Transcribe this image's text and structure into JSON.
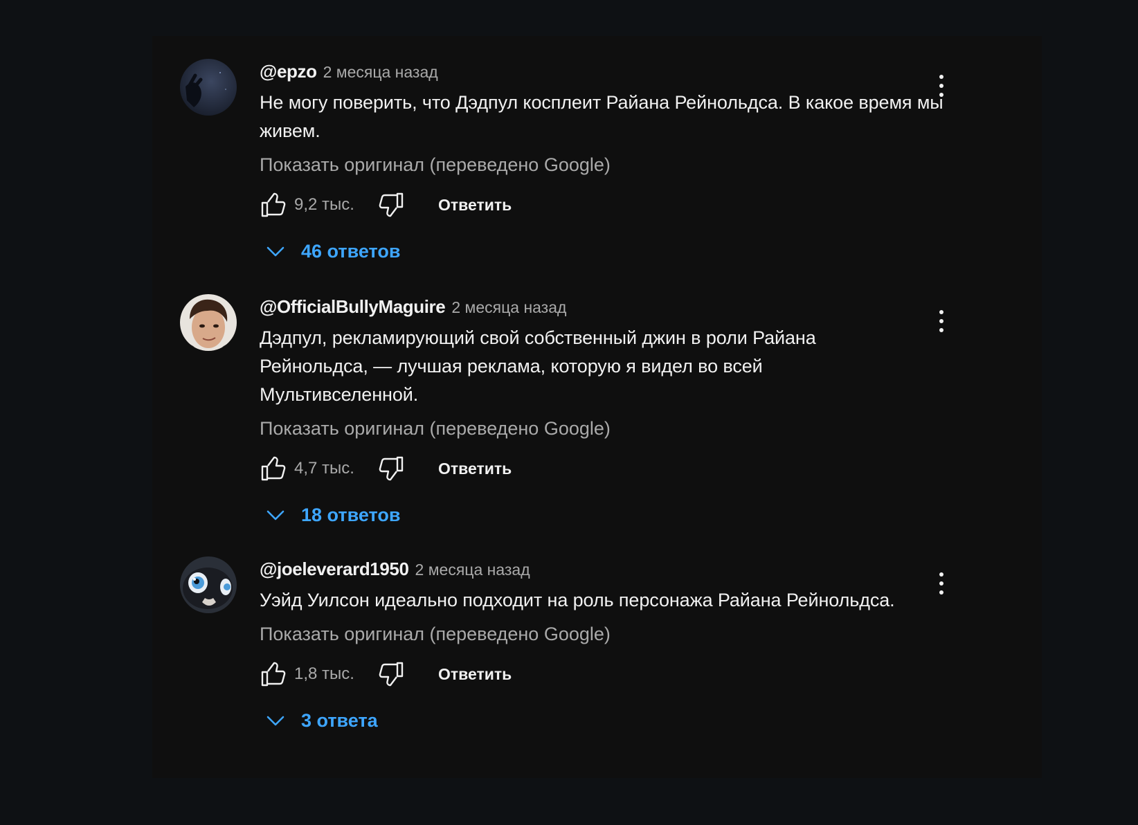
{
  "comments": [
    {
      "author": "@epzo",
      "time": "2 месяца назад",
      "text": "Не могу поверить, что Дэдпул косплеит Райана Рейнольдса. В какое время мы живем.",
      "translation": "Показать оригинал (переведено Google)",
      "likes": "9,2 тыс.",
      "reply_label": "Ответить",
      "replies_label": "46 ответов"
    },
    {
      "author": "@OfficialBullyMaguire",
      "time": "2 месяца назад",
      "text": "Дэдпул, рекламирующий свой собственный джин в роли Райана Рейнольдса, — лучшая реклама, которую я видел во всей Мультивселенной.",
      "translation": "Показать оригинал (переведено Google)",
      "likes": "4,7 тыс.",
      "reply_label": "Ответить",
      "replies_label": "18 ответов"
    },
    {
      "author": "@joeleverard1950",
      "time": "2 месяца назад",
      "text": "Уэйд Уилсон идеально подходит на роль персонажа Райана Рейнольдса.",
      "translation": "Показать оригинал (переведено Google)",
      "likes": "1,8 тыс.",
      "reply_label": "Ответить",
      "replies_label": "3 ответа"
    }
  ],
  "icons": {
    "like": "thumb-up-icon",
    "dislike": "thumb-down-icon",
    "expand": "chevron-down-icon",
    "menu": "more-vertical-icon"
  },
  "colors": {
    "link": "#3ea6ff",
    "secondary_text": "#aaaaaa",
    "primary_text": "#f1f1f1",
    "background": "#0f0f0f"
  }
}
